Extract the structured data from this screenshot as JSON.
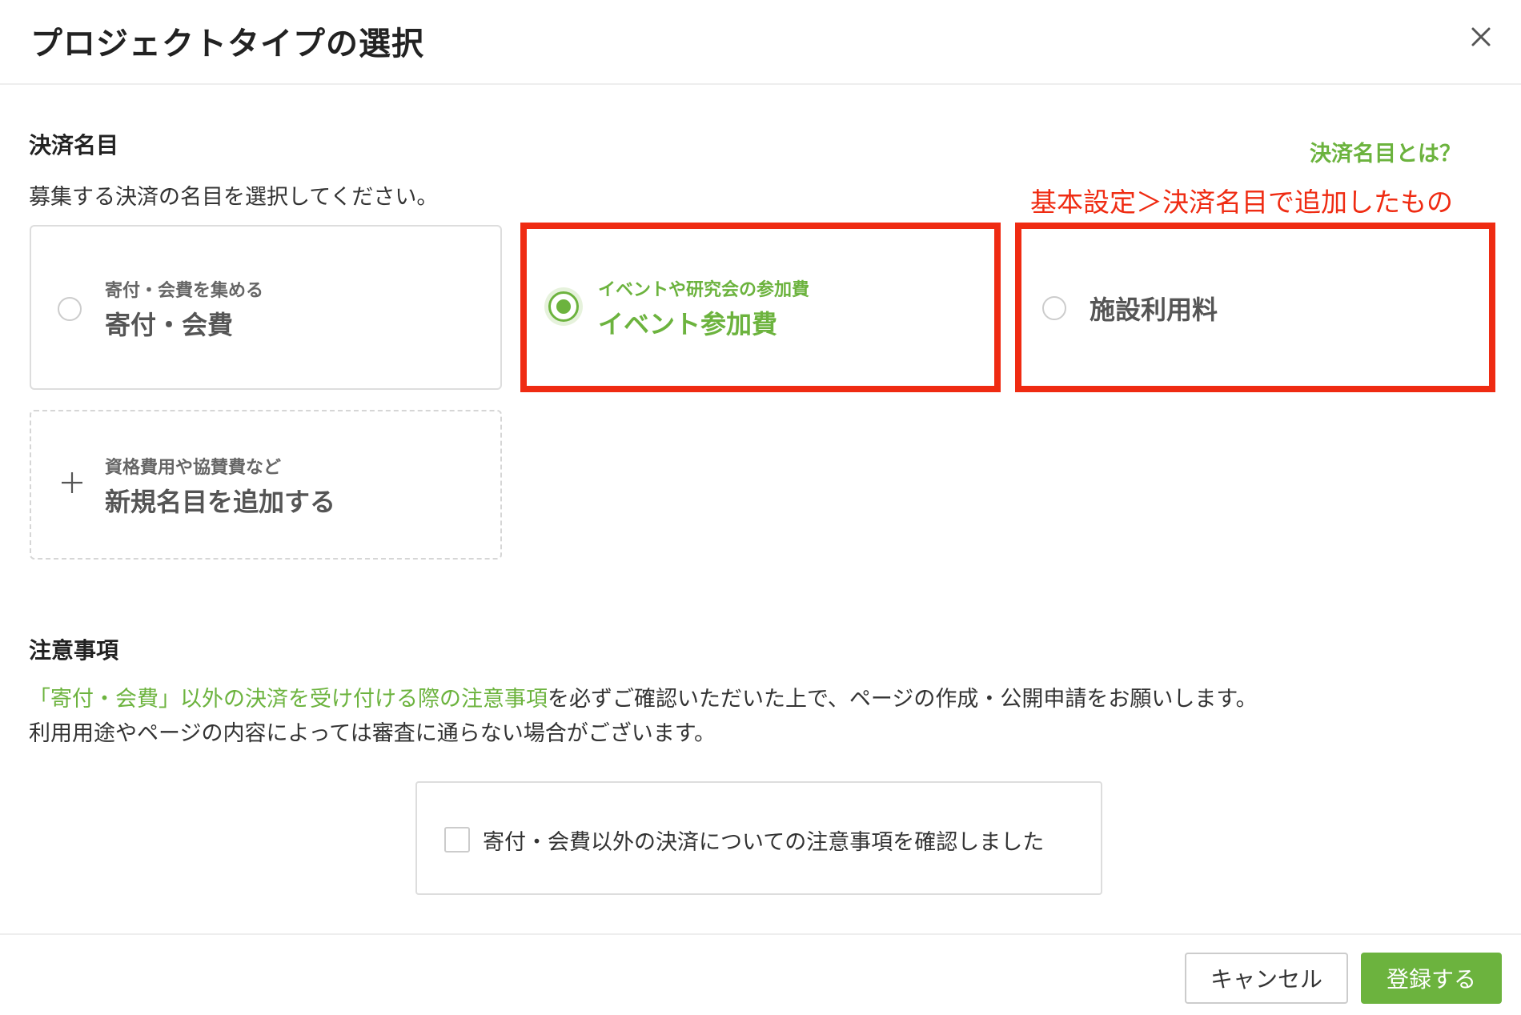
{
  "header": {
    "title": "プロジェクトタイプの選択",
    "close_icon": "close-icon"
  },
  "payment_section": {
    "title": "決済名目",
    "help_link": "決済名目とは？",
    "description": "募集する決済の名目を選択してください。",
    "annotation": "基本設定＞決済名目で追加したもの",
    "options": [
      {
        "sub": "寄付・会費を集める",
        "label": "寄付・会費",
        "selected": false
      },
      {
        "sub": "イベントや研究会の参加費",
        "label": "イベント参加費",
        "selected": true
      },
      {
        "sub": "",
        "label": "施設利用料",
        "selected": false
      }
    ],
    "add_new": {
      "sub": "資格費用や協賛費など",
      "label": "新規名目を追加する",
      "icon": "plus-icon"
    }
  },
  "notice_section": {
    "title": "注意事項",
    "link_text": "「寄付・会費」以外の決済を受け付ける際の注意事項",
    "text_after_link": "を必ずご確認いただいた上で、ページの作成・公開申請をお願いします。",
    "line2": "利用用途やページの内容によっては審査に通らない場合がございます。",
    "confirm_label": "寄付・会費以外の決済についての注意事項を確認しました",
    "confirm_checked": false
  },
  "footer": {
    "cancel_label": "キャンセル",
    "submit_label": "登録する"
  },
  "colors": {
    "accent": "#6cb33e",
    "annotation_red": "#ef2b12",
    "border": "#dddddd"
  }
}
